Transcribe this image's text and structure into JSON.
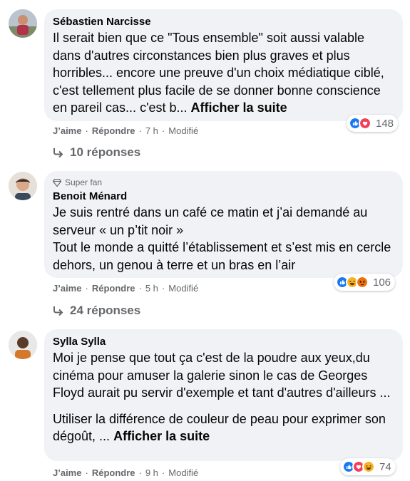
{
  "colors": {
    "like": "#1877f2",
    "love": "#f33e58",
    "haha": "#f7b125",
    "angry": "#e9710f",
    "meta_text": "#65676b",
    "bubble": "#f0f2f5"
  },
  "comments": [
    {
      "author": "Sébastien Narcisse",
      "badge": "",
      "text": "Il serait bien que ce \"Tous ensemble\" soit aussi valable dans d'autres circonstances bien plus graves et plus horribles... encore une preuve d'un choix médiatique ciblé, c'est tellement plus facile de se donner bonne conscience en pareil cas... c'est b...",
      "see_more": "Afficher la suite",
      "like": "J’aime",
      "reply": "Répondre",
      "time": "7 h",
      "edited": "Modifié",
      "reaction_count": "148",
      "reaction_icons": [
        "like-icon",
        "love-icon"
      ],
      "replies": "10 réponses"
    },
    {
      "author": "Benoit Ménard",
      "badge": "Super fan",
      "text": "Je suis rentré dans un café ce matin et j’ai demandé au serveur « un p’tit noir »\nTout le monde a quitté l’établissement et s’est mis en cercle dehors, un genou à terre et un bras en l’air",
      "see_more": "",
      "like": "J’aime",
      "reply": "Répondre",
      "time": "5 h",
      "edited": "Modifié",
      "reaction_count": "106",
      "reaction_icons": [
        "like-icon",
        "haha-icon",
        "angry-icon"
      ],
      "replies": "24 réponses"
    },
    {
      "author": "Sylla Sylla",
      "badge": "",
      "text": "Moi je pense que tout ça c'est de la poudre aux yeux,du cinéma pour amuser la galerie sinon le cas de Georges Floyd aurait pu servir d'exemple et tant d'autres d'ailleurs ...",
      "text2": "Utiliser la différence de couleur de peau pour exprimer son dégoût, ...",
      "see_more": "Afficher la suite",
      "like": "J’aime",
      "reply": "Répondre",
      "time": "9 h",
      "edited": "Modifié",
      "reaction_count": "74",
      "reaction_icons": [
        "like-icon",
        "love-icon",
        "haha-icon"
      ],
      "replies": ""
    }
  ]
}
